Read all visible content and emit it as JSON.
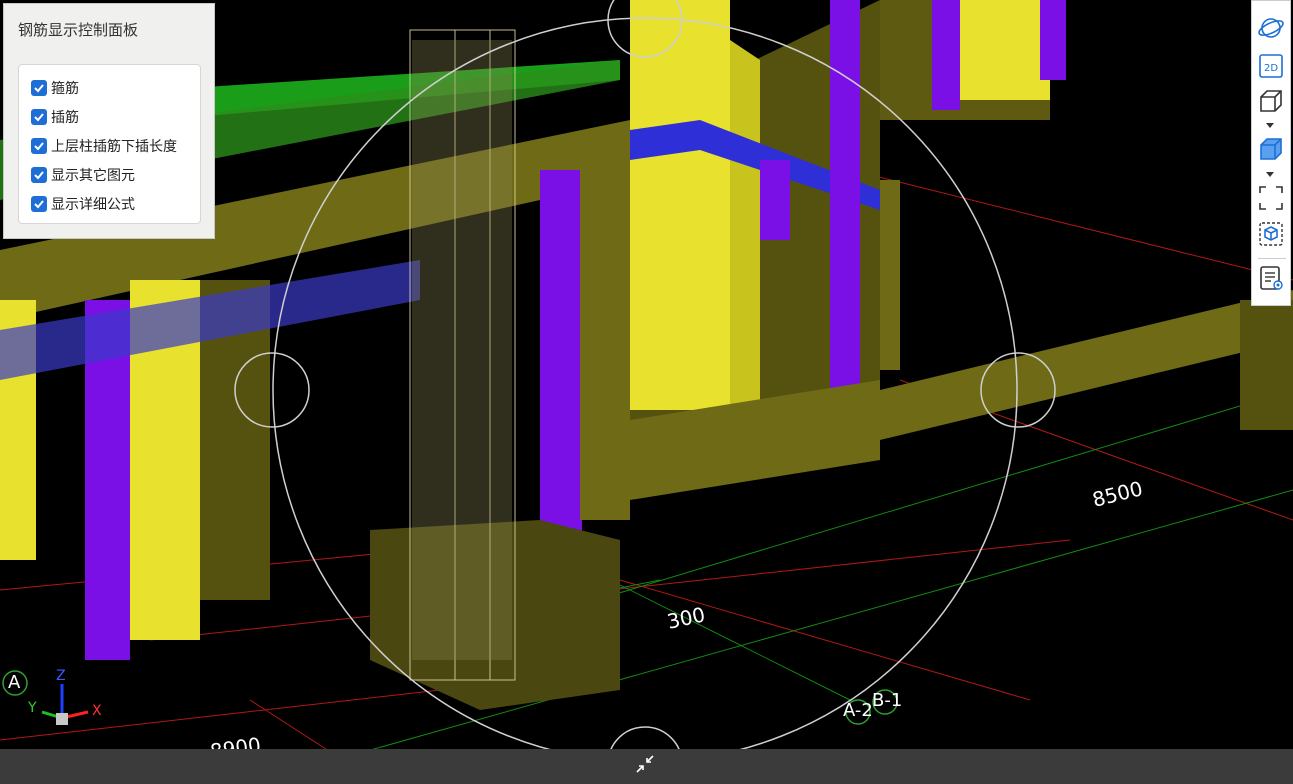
{
  "panel": {
    "title": "钢筋显示控制面板",
    "options": [
      {
        "label": "箍筋",
        "checked": true
      },
      {
        "label": "插筋",
        "checked": true
      },
      {
        "label": "上层柱插筋下插长度",
        "checked": true
      },
      {
        "label": "显示其它图元",
        "checked": true
      },
      {
        "label": "显示详细公式",
        "checked": true
      }
    ]
  },
  "dimensions": {
    "d8500": "8500",
    "d300": "300",
    "d8900": "8900"
  },
  "grid_labels": {
    "a": "A",
    "a2": "A-2",
    "b1": "B-1"
  },
  "axes": {
    "x": "X",
    "y": "Y",
    "z": "Z"
  },
  "toolbar": {
    "view2d": "2D"
  },
  "colors": {
    "olive": "#6e6a16",
    "yellow": "#e8e22e",
    "purple": "#7a10e6",
    "blue": "#2f2fd8",
    "green": "#1a9e1a",
    "checkbox": "#1d6fd6"
  }
}
